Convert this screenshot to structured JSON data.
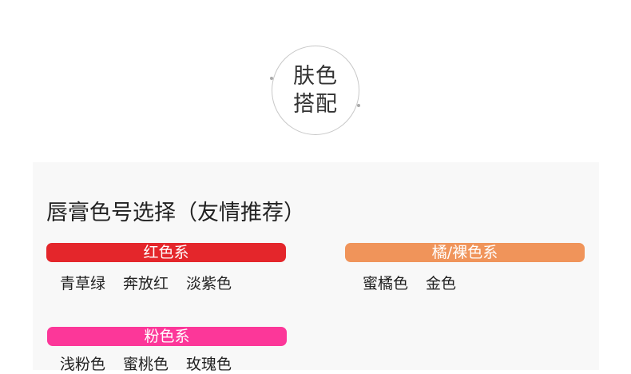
{
  "badge": {
    "line1": "肤色",
    "line2": "搭配"
  },
  "section": {
    "title": "唇膏色号选择（友情推荐）",
    "groups": [
      {
        "label": "红色系",
        "color": "#e4262b",
        "items": [
          "青草绿",
          "奔放红",
          "淡紫色"
        ]
      },
      {
        "label": "橘/裸色系",
        "color": "#f0945a",
        "items": [
          "蜜橘色",
          "金色"
        ]
      },
      {
        "label": "粉色系",
        "color": "#fc3799",
        "items": [
          "浅粉色",
          "蜜桃色",
          "玫瑰色"
        ]
      }
    ]
  }
}
